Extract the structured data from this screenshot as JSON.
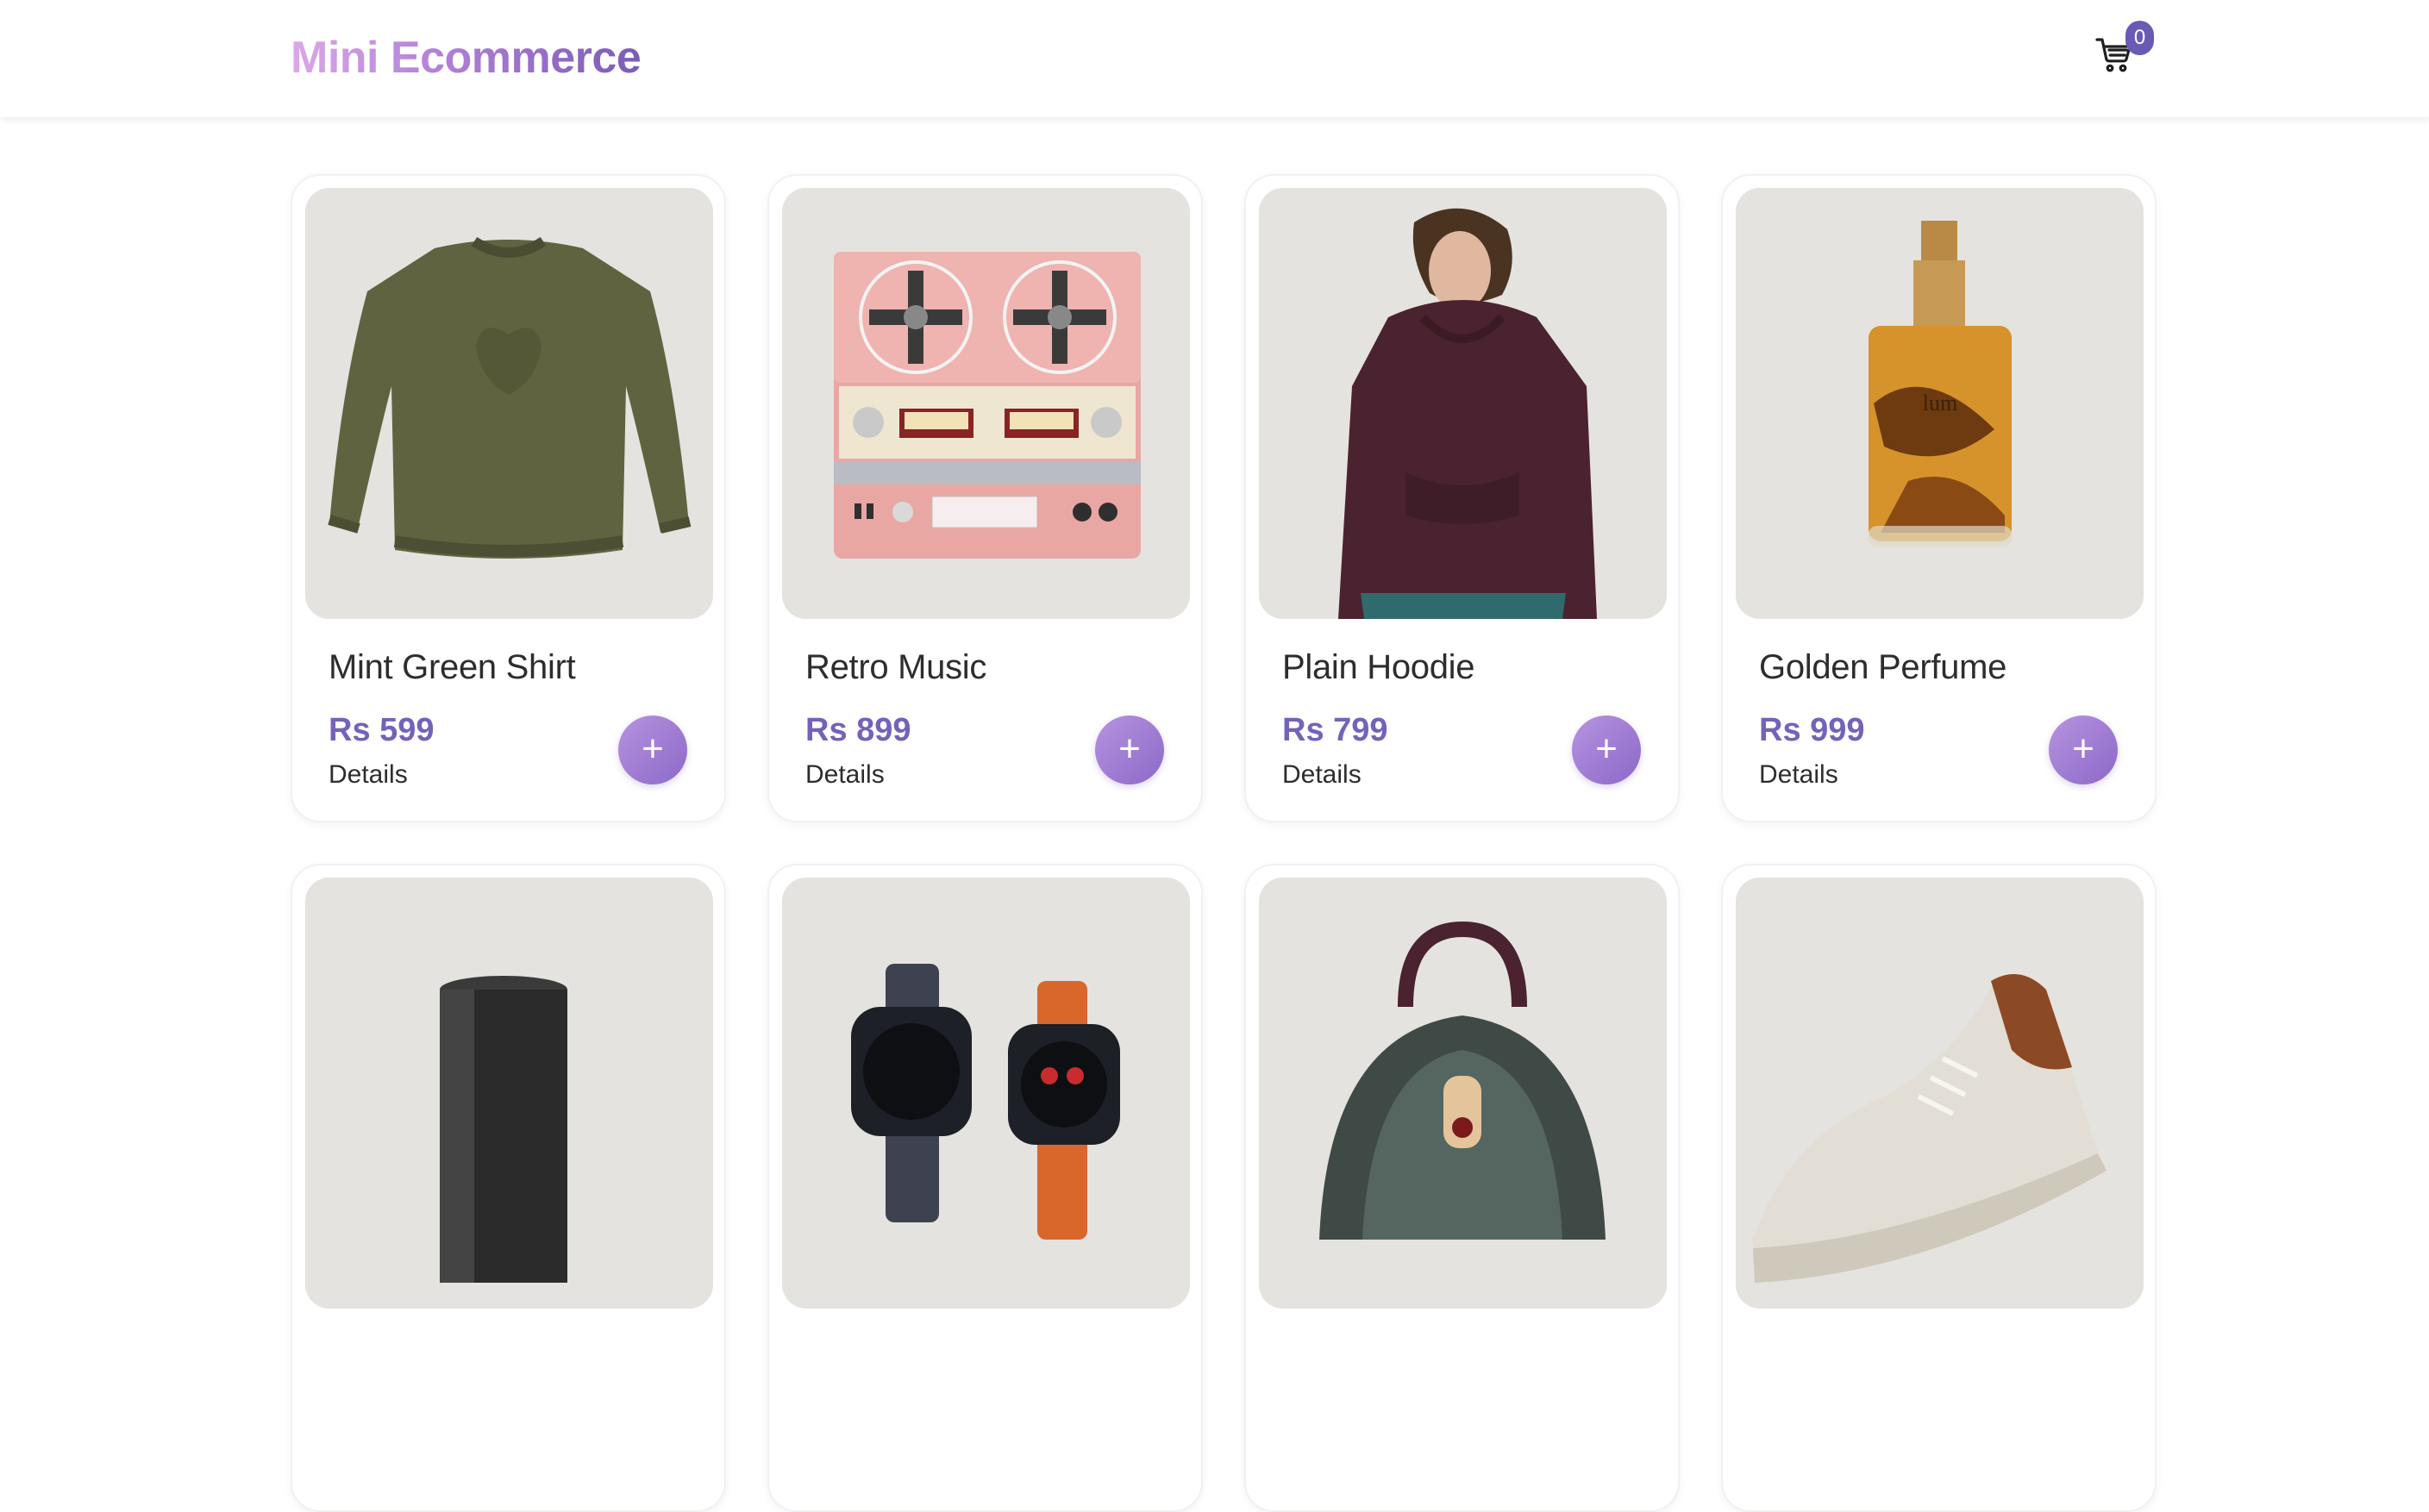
{
  "header": {
    "brand": "Mini Ecommerce",
    "cart_count": "0"
  },
  "colors": {
    "accent": "#7562b8",
    "badge": "#6b5ab4",
    "card_bg": "#e5e3df"
  },
  "products": [
    {
      "name": "Mint Green Shirt",
      "price": "Rs 599",
      "details": "Details",
      "add": "+",
      "icon": "sweater-image"
    },
    {
      "name": "Retro Music",
      "price": "Rs 899",
      "details": "Details",
      "add": "+",
      "icon": "tape-recorder-image"
    },
    {
      "name": "Plain Hoodie",
      "price": "Rs 799",
      "details": "Details",
      "add": "+",
      "icon": "hoodie-image"
    },
    {
      "name": "Golden Perfume",
      "price": "Rs 999",
      "details": "Details",
      "add": "+",
      "icon": "perfume-image"
    },
    {
      "icon": "speaker-image"
    },
    {
      "icon": "smartwatch-image"
    },
    {
      "icon": "handbag-image"
    },
    {
      "icon": "sneaker-image"
    }
  ]
}
